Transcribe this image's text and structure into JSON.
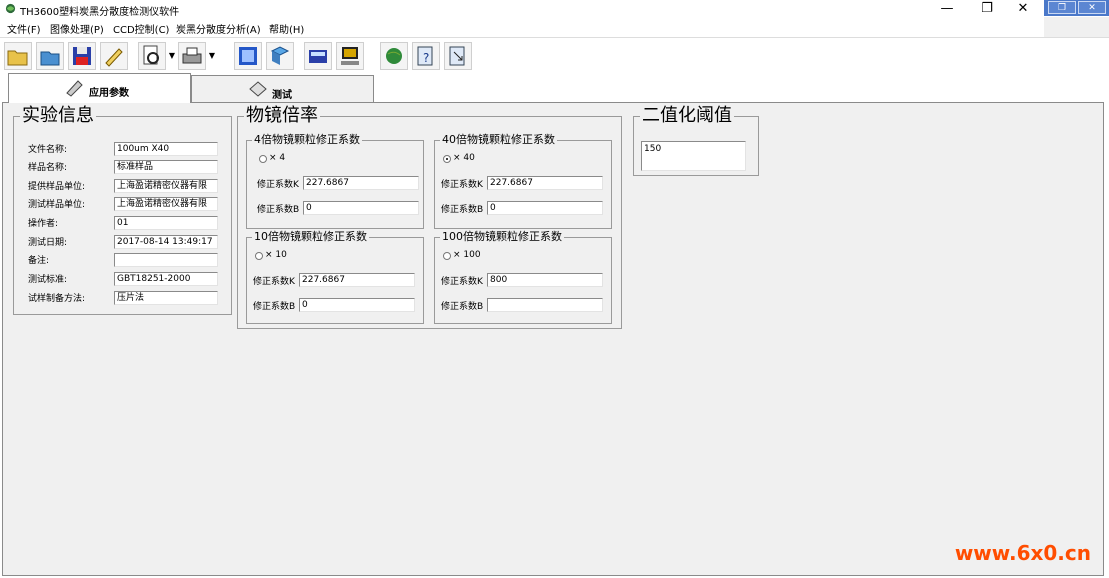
{
  "window": {
    "title": "TH3600塑料炭黑分散度检测仪软件",
    "controls": {
      "minimize": "—",
      "maximize": "❐",
      "close": "✕"
    },
    "mdi_controls": {
      "restore": "❐",
      "close": "✕"
    }
  },
  "menu": [
    "文件(F)",
    "图像处理(P)",
    "CCD控制(C)",
    "炭黑分散度分析(A)",
    "帮助(H)"
  ],
  "toolbar": {
    "buttons": [
      "open-folder-icon",
      "open-file-icon",
      "save-disk-icon",
      "edit-pen-icon",
      "print-preview-icon",
      "print-icon",
      "select-window-icon",
      "analyze-icon",
      "calculator-icon",
      "computer-icon",
      "globe-icon",
      "help-icon",
      "context-help-icon"
    ],
    "dropdown_arrow": "▼"
  },
  "tabs": [
    {
      "label": "应用参数",
      "active": true
    },
    {
      "label": "测试",
      "active": false
    }
  ],
  "experiment_info": {
    "title": "实验信息",
    "fields": [
      {
        "label": "文件名称:",
        "value": "100um  X40"
      },
      {
        "label": "样品名称:",
        "value": "标准样品"
      },
      {
        "label": "提供样品单位:",
        "value": "上海盈诺精密仪器有限"
      },
      {
        "label": "测试样品单位:",
        "value": "上海盈诺精密仪器有限"
      },
      {
        "label": "操作者:",
        "value": "01"
      },
      {
        "label": "测试日期:",
        "value": "2017-08-14 13:49:17"
      },
      {
        "label": "备注:",
        "value": ""
      },
      {
        "label": "测试标准:",
        "value": "GBT18251-2000"
      },
      {
        "label": "试样制备方法:",
        "value": "压片法"
      }
    ]
  },
  "magnification": {
    "title": "物镜倍率",
    "groups": [
      {
        "title": "4倍物镜颗粒修正系数",
        "option": "× 4",
        "selected": false,
        "k_label": "修正系数K",
        "k": "227.6867",
        "b_label": "修正系数B",
        "b": "0"
      },
      {
        "title": "40倍物镜颗粒修正系数",
        "option": "× 40",
        "selected": true,
        "k_label": "修正系数K",
        "k": "227.6867",
        "b_label": "修正系数B",
        "b": "0"
      },
      {
        "title": "10倍物镜颗粒修正系数",
        "option": "× 10",
        "selected": false,
        "k_label": "修正系数K",
        "k": "227.6867",
        "b_label": "修正系数B",
        "b": "0"
      },
      {
        "title": "100倍物镜颗粒修正系数",
        "option": "× 100",
        "selected": false,
        "k_label": "修正系数K",
        "k": "800",
        "b_label": "修正系数B",
        "b": ""
      }
    ]
  },
  "binarization": {
    "title": "二值化阈值",
    "value": "150"
  },
  "watermark": "www.6x0.cn",
  "colors": {
    "content_bg": "#f0f0f0",
    "watermark": "#ff4d00",
    "mdi_blue": "#4a78c9"
  }
}
